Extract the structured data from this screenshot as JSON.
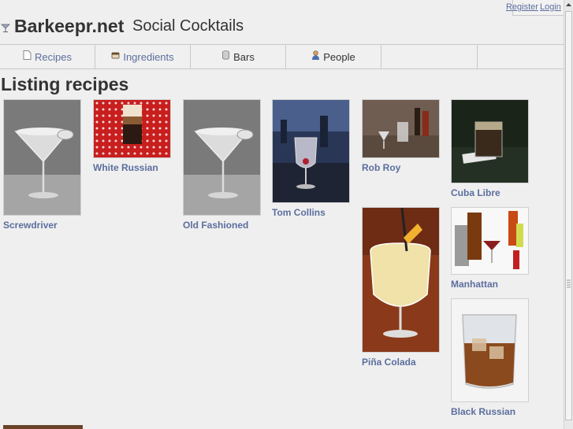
{
  "site": {
    "name": "Barkeepr.net",
    "tagline": "Social Cocktails",
    "logo_icon": "cocktail-glass-icon"
  },
  "account": {
    "register_label": "Register",
    "login_label": "Login"
  },
  "nav": {
    "items": [
      {
        "label": "Recipes",
        "icon": "page-icon"
      },
      {
        "label": "Ingredients",
        "icon": "cup-icon"
      },
      {
        "label": "Bars",
        "icon": "cylinder-icon"
      },
      {
        "label": "People",
        "icon": "person-icon"
      },
      {
        "label": ""
      },
      {
        "label": ""
      }
    ]
  },
  "page": {
    "title": "Listing recipes"
  },
  "recipes": [
    {
      "name": "Screwdriver"
    },
    {
      "name": "White Russian"
    },
    {
      "name": "Old Fashioned"
    },
    {
      "name": "Tom Collins"
    },
    {
      "name": "Rob Roy"
    },
    {
      "name": "Cuba Libre"
    },
    {
      "name": "Piña Colada"
    },
    {
      "name": "Manhattan"
    },
    {
      "name": "Black Russian"
    }
  ],
  "colors": {
    "link": "#5b6e9e",
    "text": "#333333",
    "background": "#efefef",
    "border": "#c8c8c8"
  }
}
